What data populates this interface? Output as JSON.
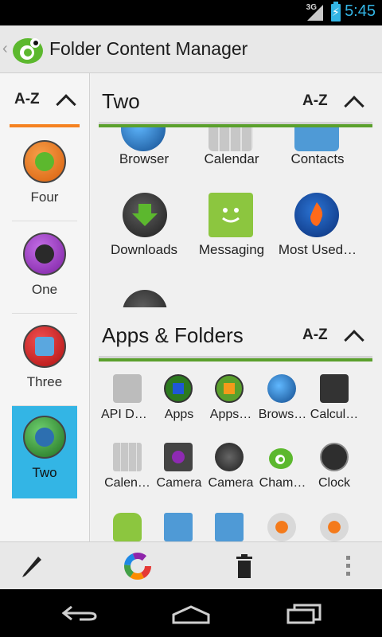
{
  "status_bar": {
    "network": "3G",
    "time": "5:45"
  },
  "action_bar": {
    "title": "Folder Content Manager"
  },
  "sidebar": {
    "sort_label": "A-Z",
    "items": [
      {
        "label": "Four",
        "color": "#e8751a"
      },
      {
        "label": "One",
        "color": "#8e35b5"
      },
      {
        "label": "Three",
        "color": "#c91818"
      },
      {
        "label": "Two",
        "color": "#2a7a2a",
        "selected": true
      }
    ]
  },
  "folder_section": {
    "title": "Two",
    "sort_label": "A-Z",
    "apps": [
      {
        "label": "Browser"
      },
      {
        "label": "Calendar"
      },
      {
        "label": "Contacts"
      },
      {
        "label": "Downloads"
      },
      {
        "label": "Messaging"
      },
      {
        "label": "Most Used…"
      }
    ]
  },
  "apps_section": {
    "title": "Apps & Folders",
    "sort_label": "A-Z",
    "apps": [
      {
        "label": "API De…"
      },
      {
        "label": "Apps"
      },
      {
        "label": "Apps…"
      },
      {
        "label": "Brows…"
      },
      {
        "label": "Calcul…"
      },
      {
        "label": "Calen…"
      },
      {
        "label": "Camera"
      },
      {
        "label": "Camera"
      },
      {
        "label": "Cham…"
      },
      {
        "label": "Clock"
      }
    ]
  },
  "bottom_actions": [
    "edit-icon",
    "color-wheel-icon",
    "trash-icon",
    "overflow-menu-icon"
  ],
  "colors": {
    "accent": "#33b5e5",
    "orange": "#f58220",
    "green": "#5aa02c"
  }
}
